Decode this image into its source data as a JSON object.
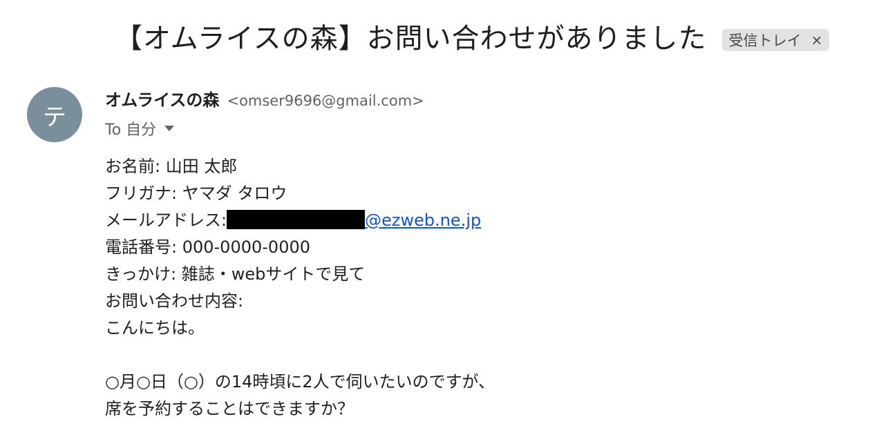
{
  "subject": "【オムライスの森】お問い合わせがありました",
  "label": {
    "text": "受信トレイ",
    "close_glyph": "×"
  },
  "sender": {
    "avatar_letter": "テ",
    "avatar_color": "#7a8f9c",
    "name": "オムライスの森",
    "email": "<omser9696@gmail.com>",
    "to": "To 自分"
  },
  "body": {
    "name_line": "お名前: 山田 太郎",
    "furigana_line": "フリガナ: ヤマダ タロウ",
    "email_label": "メールアドレス:",
    "email_domain": "@ezweb.ne.jp",
    "phone_line": "電話番号: 000-0000-0000",
    "trigger_line": "きっかけ: 雑誌・webサイトで見て",
    "inquiry_label": "お問い合わせ内容:",
    "greeting": "こんにちは。",
    "message_line1": "○月○日（○）の14時頃に2人で伺いたいのですが、",
    "message_line2": "席を予約することはできますか？"
  },
  "colors": {
    "link": "#1155cc",
    "chip_bg": "#e2e2e2"
  }
}
